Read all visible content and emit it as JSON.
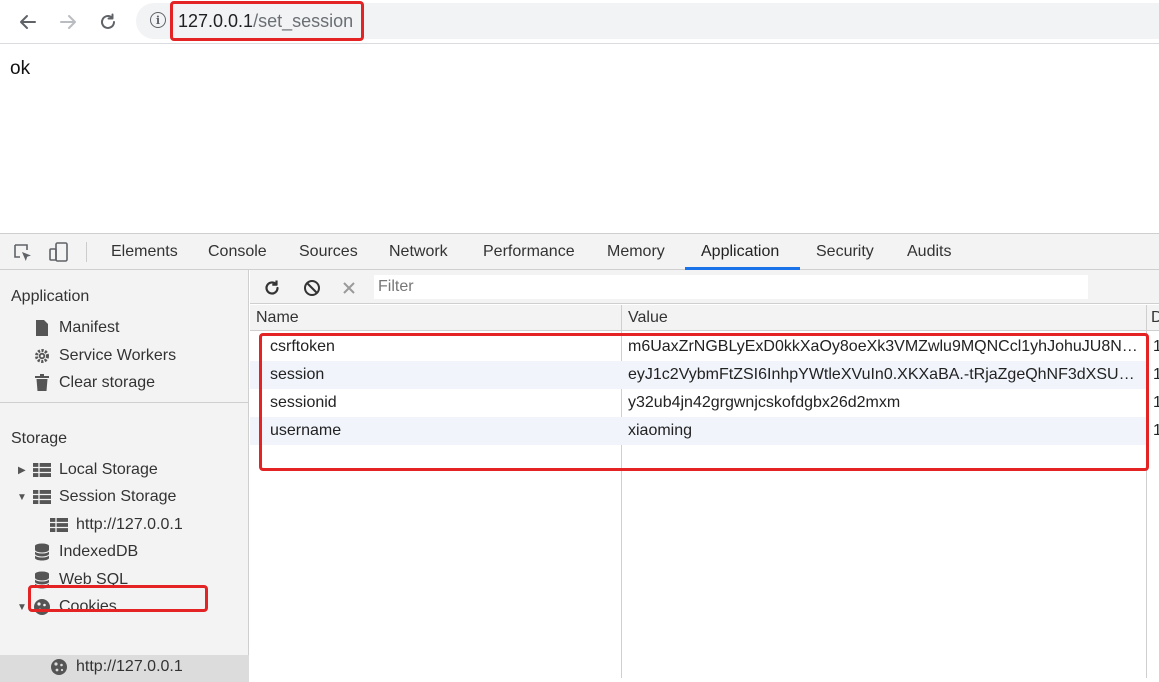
{
  "browser": {
    "url_host": "127.0.0.1",
    "url_path": "/set_session",
    "icons": [
      "back-arrow-icon",
      "forward-arrow-icon",
      "reload-icon",
      "info-icon"
    ]
  },
  "page": {
    "body_text": "ok"
  },
  "devtools": {
    "tabs": [
      {
        "label": "Elements"
      },
      {
        "label": "Console"
      },
      {
        "label": "Sources"
      },
      {
        "label": "Network"
      },
      {
        "label": "Performance"
      },
      {
        "label": "Memory"
      },
      {
        "label": "Application"
      },
      {
        "label": "Security"
      },
      {
        "label": "Audits"
      }
    ],
    "active_tab": "Application",
    "sidebar": {
      "application_header": "Application",
      "application_items": [
        {
          "label": "Manifest",
          "icon": "file-icon"
        },
        {
          "label": "Service Workers",
          "icon": "gear-icon"
        },
        {
          "label": "Clear storage",
          "icon": "trash-icon"
        }
      ],
      "storage_header": "Storage",
      "storage_items": [
        {
          "label": "Local Storage",
          "icon": "grid-icon"
        },
        {
          "label": "Session Storage",
          "icon": "grid-icon"
        },
        {
          "label": "http://127.0.0.1",
          "icon": "grid-icon"
        },
        {
          "label": "IndexedDB",
          "icon": "database-icon"
        },
        {
          "label": "Web SQL",
          "icon": "database-icon"
        },
        {
          "label": "Cookies",
          "icon": "cookie-icon"
        },
        {
          "label": "http://127.0.0.1",
          "icon": "cookie-icon"
        }
      ]
    },
    "filter": {
      "placeholder": "Filter"
    },
    "table": {
      "columns": [
        "Name",
        "Value",
        "D"
      ],
      "rows": [
        {
          "name": "csrftoken",
          "value": "m6UaxZrNGBLyExD0kkXaOy8oeXk3VMZwlu9MQNCcl1yhJohuJU8Nl...",
          "d": "1"
        },
        {
          "name": "session",
          "value": "eyJ1c2VybmFtZSI6InhpYWtleXVuIn0.XKXaBA.-tRjaZgeQhNF3dXSUTd...",
          "d": "1"
        },
        {
          "name": "sessionid",
          "value": "y32ub4jn42grgwnjcskofdgbx26d2mxm",
          "d": "1"
        },
        {
          "name": "username",
          "value": "xiaoming",
          "d": "1"
        }
      ]
    }
  },
  "colors": {
    "highlight": "#e42424",
    "active_tab": "#1a73e8"
  }
}
